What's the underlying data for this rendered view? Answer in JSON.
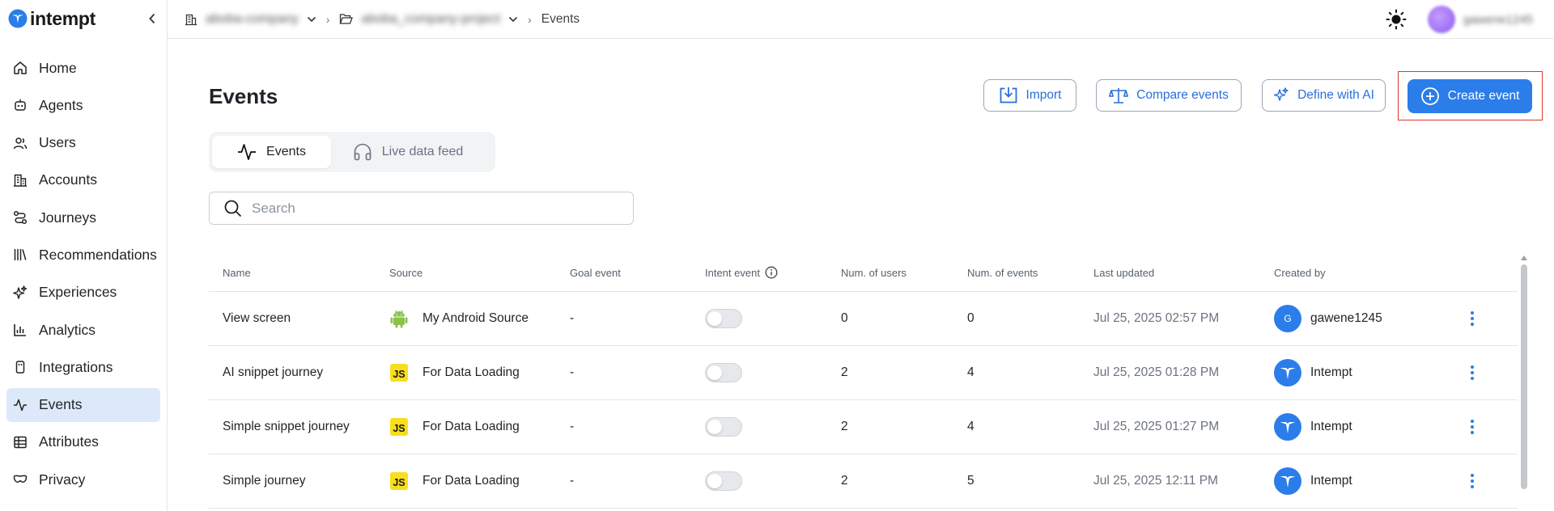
{
  "brand": {
    "name": "intempt"
  },
  "sidebar": {
    "items": [
      {
        "label": "Home",
        "icon": "home-icon"
      },
      {
        "label": "Agents",
        "icon": "robot-icon"
      },
      {
        "label": "Users",
        "icon": "users-icon"
      },
      {
        "label": "Accounts",
        "icon": "building-icon"
      },
      {
        "label": "Journeys",
        "icon": "route-icon"
      },
      {
        "label": "Recommendations",
        "icon": "library-icon"
      },
      {
        "label": "Experiences",
        "icon": "sparkles-icon"
      },
      {
        "label": "Analytics",
        "icon": "bar-chart-icon"
      },
      {
        "label": "Integrations",
        "icon": "plug-icon"
      },
      {
        "label": "Events",
        "icon": "activity-icon",
        "active": true
      },
      {
        "label": "Attributes",
        "icon": "table-icon"
      },
      {
        "label": "Privacy",
        "icon": "mask-icon"
      }
    ]
  },
  "topbar": {
    "org": "aboba-company",
    "project": "aboba_company-project",
    "current": "Events",
    "username": "gawene1245"
  },
  "page": {
    "title": "Events",
    "actions": {
      "import": "Import",
      "compare": "Compare events",
      "define_ai": "Define with AI",
      "create": "Create event"
    },
    "tabs": {
      "events": "Events",
      "live_feed": "Live data feed"
    },
    "search": {
      "placeholder": "Search",
      "value": ""
    }
  },
  "table": {
    "headers": {
      "name": "Name",
      "source": "Source",
      "goal": "Goal event",
      "intent": "Intent event",
      "users": "Num. of users",
      "events": "Num. of events",
      "updated": "Last updated",
      "created_by": "Created by"
    },
    "rows": [
      {
        "name": "View screen",
        "source": "My Android Source",
        "source_type": "android",
        "goal": "-",
        "intent": false,
        "users": "0",
        "events": "0",
        "updated": "Jul 25, 2025 02:57 PM",
        "created_by": "gawene1245",
        "creator_type": "user",
        "avatar_letter": "G"
      },
      {
        "name": "AI snippet journey",
        "source": "For Data Loading",
        "source_type": "js",
        "goal": "-",
        "intent": false,
        "users": "2",
        "events": "4",
        "updated": "Jul 25, 2025 01:28 PM",
        "created_by": "Intempt",
        "creator_type": "system"
      },
      {
        "name": "Simple snippet journey",
        "source": "For Data Loading",
        "source_type": "js",
        "goal": "-",
        "intent": false,
        "users": "2",
        "events": "4",
        "updated": "Jul 25, 2025 01:27 PM",
        "created_by": "Intempt",
        "creator_type": "system"
      },
      {
        "name": "Simple journey",
        "source": "For Data Loading",
        "source_type": "js",
        "goal": "-",
        "intent": false,
        "users": "2",
        "events": "5",
        "updated": "Jul 25, 2025 12:11 PM",
        "created_by": "Intempt",
        "creator_type": "system"
      }
    ],
    "js_badge": "JS"
  },
  "colors": {
    "accent": "#2b7de9",
    "active_nav_bg": "#dde9fb",
    "highlight": "#e0342f"
  }
}
